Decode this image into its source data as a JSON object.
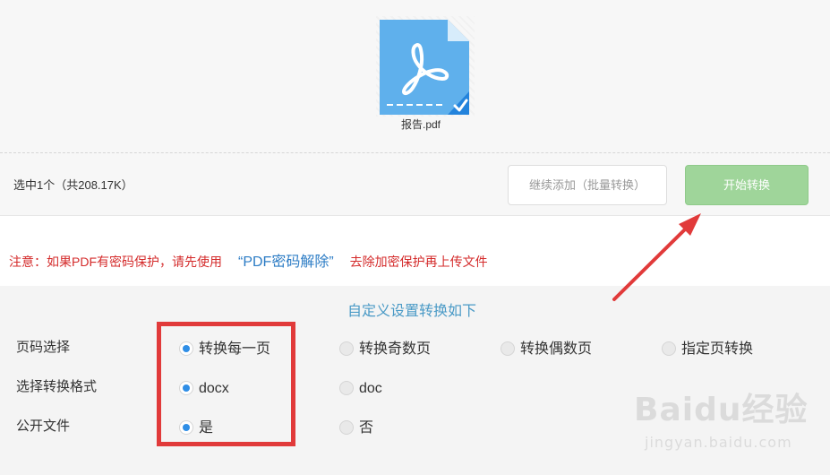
{
  "file": {
    "name": "报告.pdf",
    "icon": "pdf-file-icon",
    "selected_icon": "check-icon"
  },
  "toolbar": {
    "summary": "选中1个（共208.17K）",
    "add_more_label": "继续添加（批量转换）",
    "start_label": "开始转换"
  },
  "notice": {
    "prefix": "注意：如果PDF有密码保护，请先使用",
    "link_text": "“PDF密码解除”",
    "suffix": "去除加密保护再上传文件"
  },
  "settings": {
    "title": "自定义设置转换如下",
    "rows": [
      {
        "label": "页码选择",
        "options": [
          {
            "label": "转换每一页",
            "checked": true
          },
          {
            "label": "转换奇数页",
            "checked": false
          },
          {
            "label": "转换偶数页",
            "checked": false
          },
          {
            "label": "指定页转换",
            "checked": false
          }
        ]
      },
      {
        "label": "选择转换格式",
        "options": [
          {
            "label": "docx",
            "checked": true
          },
          {
            "label": "doc",
            "checked": false
          }
        ]
      },
      {
        "label": "公开文件",
        "options": [
          {
            "label": "是",
            "checked": true
          },
          {
            "label": "否",
            "checked": false
          }
        ]
      }
    ]
  },
  "watermark": {
    "brand": "Baidu经验",
    "url": "jingyan.baidu.com"
  },
  "colors": {
    "accent_blue": "#2f8ee6",
    "button_green": "#9fd59a",
    "notice_red": "#d42b2b",
    "link_blue": "#2c7cc5",
    "highlight_red": "#e13a3a"
  }
}
